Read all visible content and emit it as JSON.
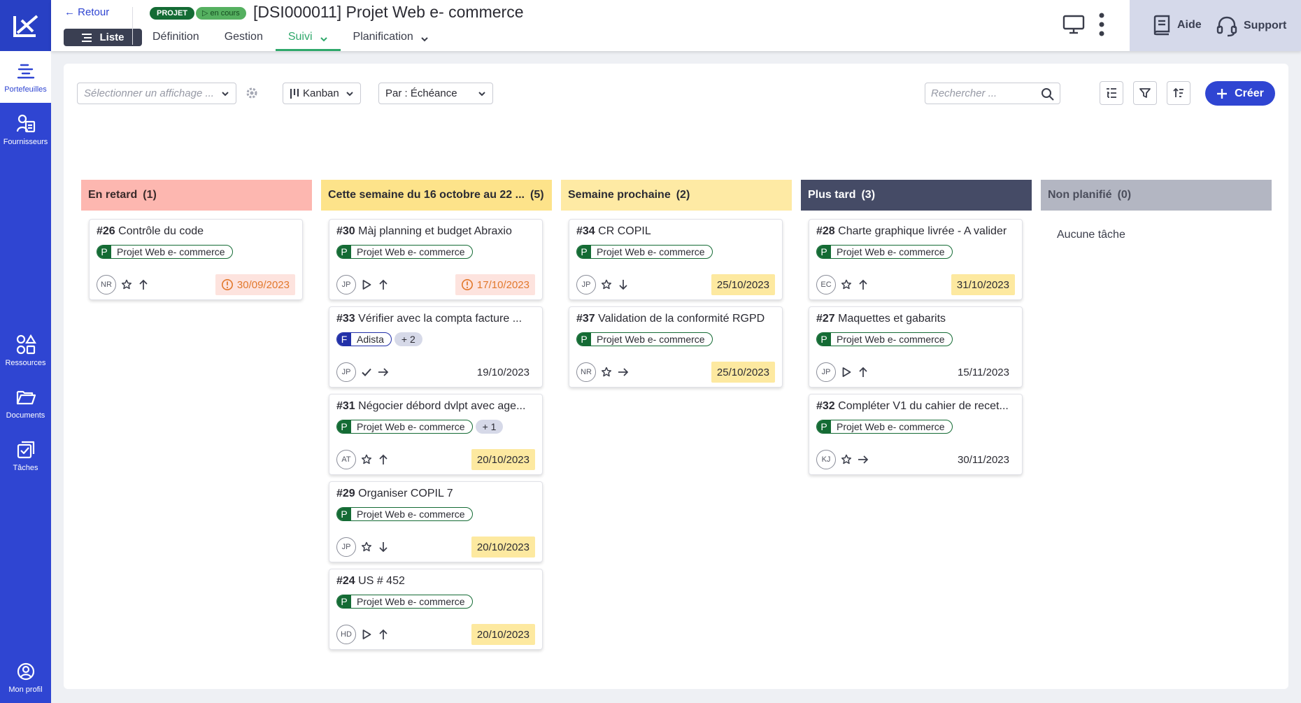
{
  "sidebar": {
    "items": [
      {
        "label": "Portefeuilles",
        "icon": "portfolio-icon"
      },
      {
        "label": "Fournisseurs",
        "icon": "suppliers-icon"
      },
      {
        "label": "Ressources",
        "icon": "resources-icon"
      },
      {
        "label": "Documents",
        "icon": "folder-icon"
      },
      {
        "label": "Tâches",
        "icon": "tasks-icon"
      },
      {
        "label": "Mon profil",
        "icon": "profile-icon"
      }
    ]
  },
  "header": {
    "back_label": "Retour",
    "list_label": "Liste",
    "badge_type": "PROJET",
    "badge_status": "en cours",
    "title": "[DSI000011] Projet Web e- commerce",
    "tabs": [
      {
        "label": "Définition"
      },
      {
        "label": "Gestion"
      },
      {
        "label": "Suivi"
      },
      {
        "label": "Planification"
      }
    ],
    "help_label": "Aide",
    "support_label": "Support"
  },
  "toolbar": {
    "display_placeholder": "Sélectionner un affichage ...",
    "view_label": "Kanban",
    "group_label": "Par : Échéance",
    "search_placeholder": "Rechercher ...",
    "create_label": "Créer"
  },
  "columns": [
    {
      "title": "En retard",
      "count": "(1)",
      "color": "#fdb7b0",
      "text_color": "#3a2a2a",
      "cards": [
        {
          "num": "#26",
          "title": "Contrôle du code",
          "tags": [
            {
              "letter": "P",
              "label": "Projet Web e- commerce"
            }
          ],
          "more": "",
          "avatar": "NR",
          "status": "star",
          "priority": "up",
          "date": "30/09/2023",
          "date_style": "red"
        }
      ]
    },
    {
      "title": "Cette semaine du 16 octobre au 22 ...",
      "count": "(5)",
      "color": "#fde38a",
      "text_color": "#2b2b33",
      "cards": [
        {
          "num": "#30",
          "title": "Màj planning et budget Abraxio",
          "tags": [
            {
              "letter": "P",
              "label": "Projet Web e- commerce"
            }
          ],
          "more": "",
          "avatar": "JP",
          "status": "play",
          "priority": "up",
          "date": "17/10/2023",
          "date_style": "red"
        },
        {
          "num": "#33",
          "title": "Vérifier avec la compta facture ...",
          "tags": [
            {
              "letter": "F",
              "label": "Adista"
            }
          ],
          "more": "+ 2",
          "avatar": "JP",
          "status": "check",
          "priority": "right",
          "date": "19/10/2023",
          "date_style": "plain"
        },
        {
          "num": "#31",
          "title": "Négocier débord dvlpt avec age...",
          "tags": [
            {
              "letter": "P",
              "label": "Projet Web e- commerce"
            }
          ],
          "more": "+ 1",
          "avatar": "AT",
          "status": "star",
          "priority": "up",
          "date": "20/10/2023",
          "date_style": "yellow"
        },
        {
          "num": "#29",
          "title": "Organiser COPIL 7",
          "tags": [
            {
              "letter": "P",
              "label": "Projet Web e- commerce"
            }
          ],
          "more": "",
          "avatar": "JP",
          "status": "star",
          "priority": "down",
          "date": "20/10/2023",
          "date_style": "yellow"
        },
        {
          "num": "#24",
          "title": "US # 452",
          "tags": [
            {
              "letter": "P",
              "label": "Projet Web e- commerce"
            }
          ],
          "more": "",
          "avatar": "HD",
          "status": "play",
          "priority": "up",
          "date": "20/10/2023",
          "date_style": "yellow"
        }
      ]
    },
    {
      "title": "Semaine prochaine",
      "count": "(2)",
      "color": "#feeaa4",
      "text_color": "#2b2b33",
      "cards": [
        {
          "num": "#34",
          "title": "CR COPIL",
          "tags": [
            {
              "letter": "P",
              "label": "Projet Web e- commerce"
            }
          ],
          "more": "",
          "avatar": "JP",
          "status": "star",
          "priority": "down",
          "date": "25/10/2023",
          "date_style": "yellow"
        },
        {
          "num": "#37",
          "title": "Validation de la conformité RGPD",
          "tags": [
            {
              "letter": "P",
              "label": "Projet Web e- commerce"
            }
          ],
          "more": "",
          "avatar": "NR",
          "status": "star",
          "priority": "right",
          "date": "25/10/2023",
          "date_style": "yellow"
        }
      ]
    },
    {
      "title": "Plus tard",
      "count": "(3)",
      "color": "#454b66",
      "text_color": "#ffffff",
      "cards": [
        {
          "num": "#28",
          "title": "Charte graphique livrée - A valider",
          "tags": [
            {
              "letter": "P",
              "label": "Projet Web e- commerce"
            }
          ],
          "more": "",
          "avatar": "EC",
          "status": "star",
          "priority": "up",
          "date": "31/10/2023",
          "date_style": "yellow"
        },
        {
          "num": "#27",
          "title": "Maquettes et gabarits",
          "tags": [
            {
              "letter": "P",
              "label": "Projet Web e- commerce"
            }
          ],
          "more": "",
          "avatar": "JP",
          "status": "play",
          "priority": "up",
          "date": "15/11/2023",
          "date_style": "plain"
        },
        {
          "num": "#32",
          "title": "Compléter V1 du cahier de recet...",
          "tags": [
            {
              "letter": "P",
              "label": "Projet Web e- commerce"
            }
          ],
          "more": "",
          "avatar": "KJ",
          "status": "star",
          "priority": "right",
          "date": "30/11/2023",
          "date_style": "plain"
        }
      ]
    },
    {
      "title": "Non planifié",
      "count": "(0)",
      "color": "#b3b6c2",
      "text_color": "#4b4e5c",
      "empty_label": "Aucune tâche",
      "cards": []
    }
  ],
  "colors": {
    "brand": "#2f45d2",
    "project_green": "#146b34",
    "active_tab": "#2fa86b"
  }
}
